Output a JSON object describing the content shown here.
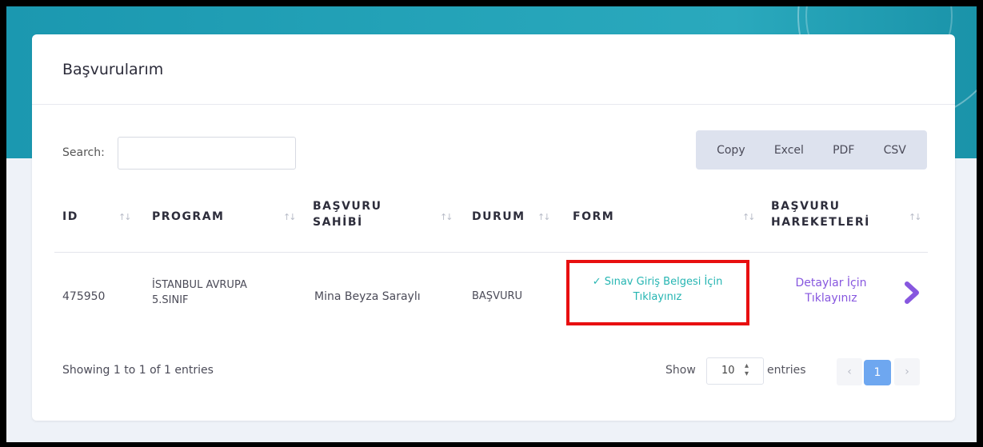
{
  "card": {
    "title": "Başvurularım"
  },
  "search": {
    "label": "Search:",
    "value": "",
    "placeholder": ""
  },
  "export_buttons": [
    "Copy",
    "Excel",
    "PDF",
    "CSV"
  ],
  "sort_icon": "sort-arrows-icon",
  "table": {
    "headers": [
      {
        "line1": "ID",
        "line2": ""
      },
      {
        "line1": "PROGRAM",
        "line2": ""
      },
      {
        "line1": "BAŞVURU",
        "line2": "SAHİBİ"
      },
      {
        "line1": "DURUM",
        "line2": ""
      },
      {
        "line1": "FORM",
        "line2": ""
      },
      {
        "line1": "BAŞVURU",
        "line2": "HAREKETLERİ"
      }
    ],
    "rows": [
      {
        "id": "475950",
        "program_line1": "İSTANBUL AVRUPA",
        "program_line2": "5.SINIF",
        "owner": "Mina Beyza Saraylı",
        "status": "BAŞVURU",
        "form_check": "✓",
        "form_line1": "Sınav Giriş Belgesi İçin",
        "form_line2": "Tıklayınız",
        "detail_line1": "Detaylar İçin",
        "detail_line2": "Tıklayınız"
      }
    ]
  },
  "footer": {
    "info": "Showing 1 to 1 of 1 entries",
    "show_label": "Show",
    "page_size": "10",
    "entries_label": "entries",
    "prev": "‹",
    "current_page": "1",
    "next": "›"
  },
  "colors": {
    "banner": "#24a3b8",
    "form_link": "#25b5b2",
    "detail_link": "#8757df",
    "highlight_box": "#e80f10",
    "active_page": "#6ea7f0"
  }
}
